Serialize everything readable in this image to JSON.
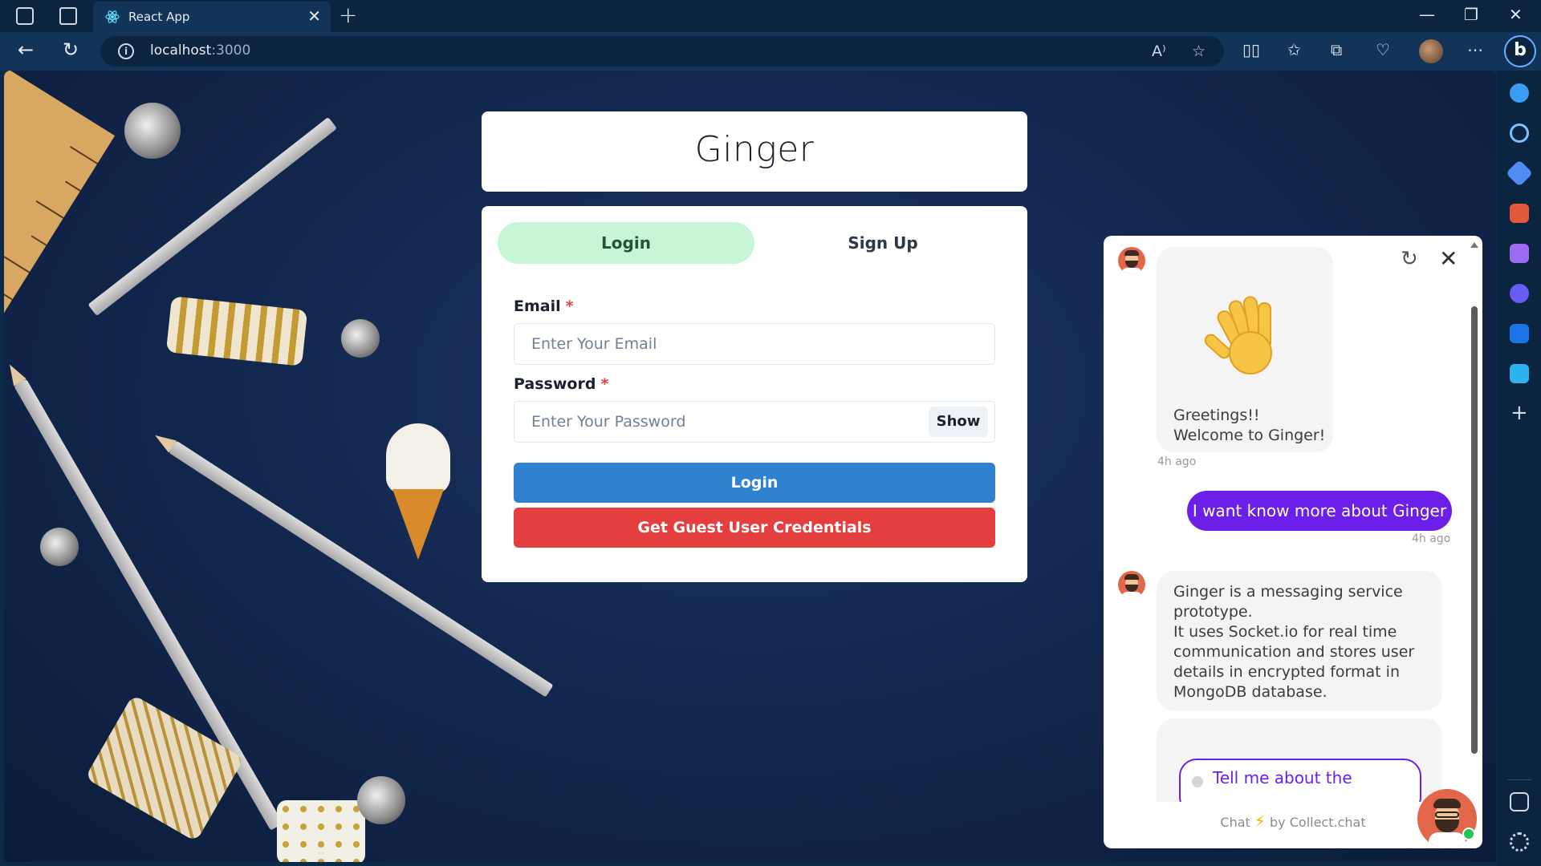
{
  "browser": {
    "tab_title": "React App",
    "url_host": "localhost",
    "url_port": ":3000",
    "read_aloud_label": "A⁾"
  },
  "app": {
    "brand": "Ginger",
    "tabs": [
      {
        "label": "Login",
        "active": true
      },
      {
        "label": "Sign Up",
        "active": false
      }
    ],
    "email_label": "Email",
    "email_placeholder": "Enter Your Email",
    "password_label": "Password",
    "password_placeholder": "Enter Your Password",
    "required_mark": "*",
    "show_label": "Show",
    "login_button": "Login",
    "guest_button": "Get Guest User Credentials"
  },
  "chat": {
    "greeting_line1": "Greetings!!",
    "greeting_line2": "Welcome to Ginger!",
    "greeting_time": "4h ago",
    "user_message": "I want know more about Ginger",
    "user_time": "4h ago",
    "bot_lines": [
      "Ginger is a messaging service",
      "prototype.",
      "It uses Socket.io for real time",
      "communication and stores user",
      "details in encrypted format in",
      "MongoDB database."
    ],
    "option_text": "Tell me about the",
    "powered_prefix": "Chat",
    "powered_suffix": "by Collect.chat"
  },
  "colors": {
    "accent_purple": "#6c1fe8",
    "login_blue": "#3182ce",
    "guest_red": "#e53e3e",
    "tab_active_green": "#c6f6d5"
  }
}
